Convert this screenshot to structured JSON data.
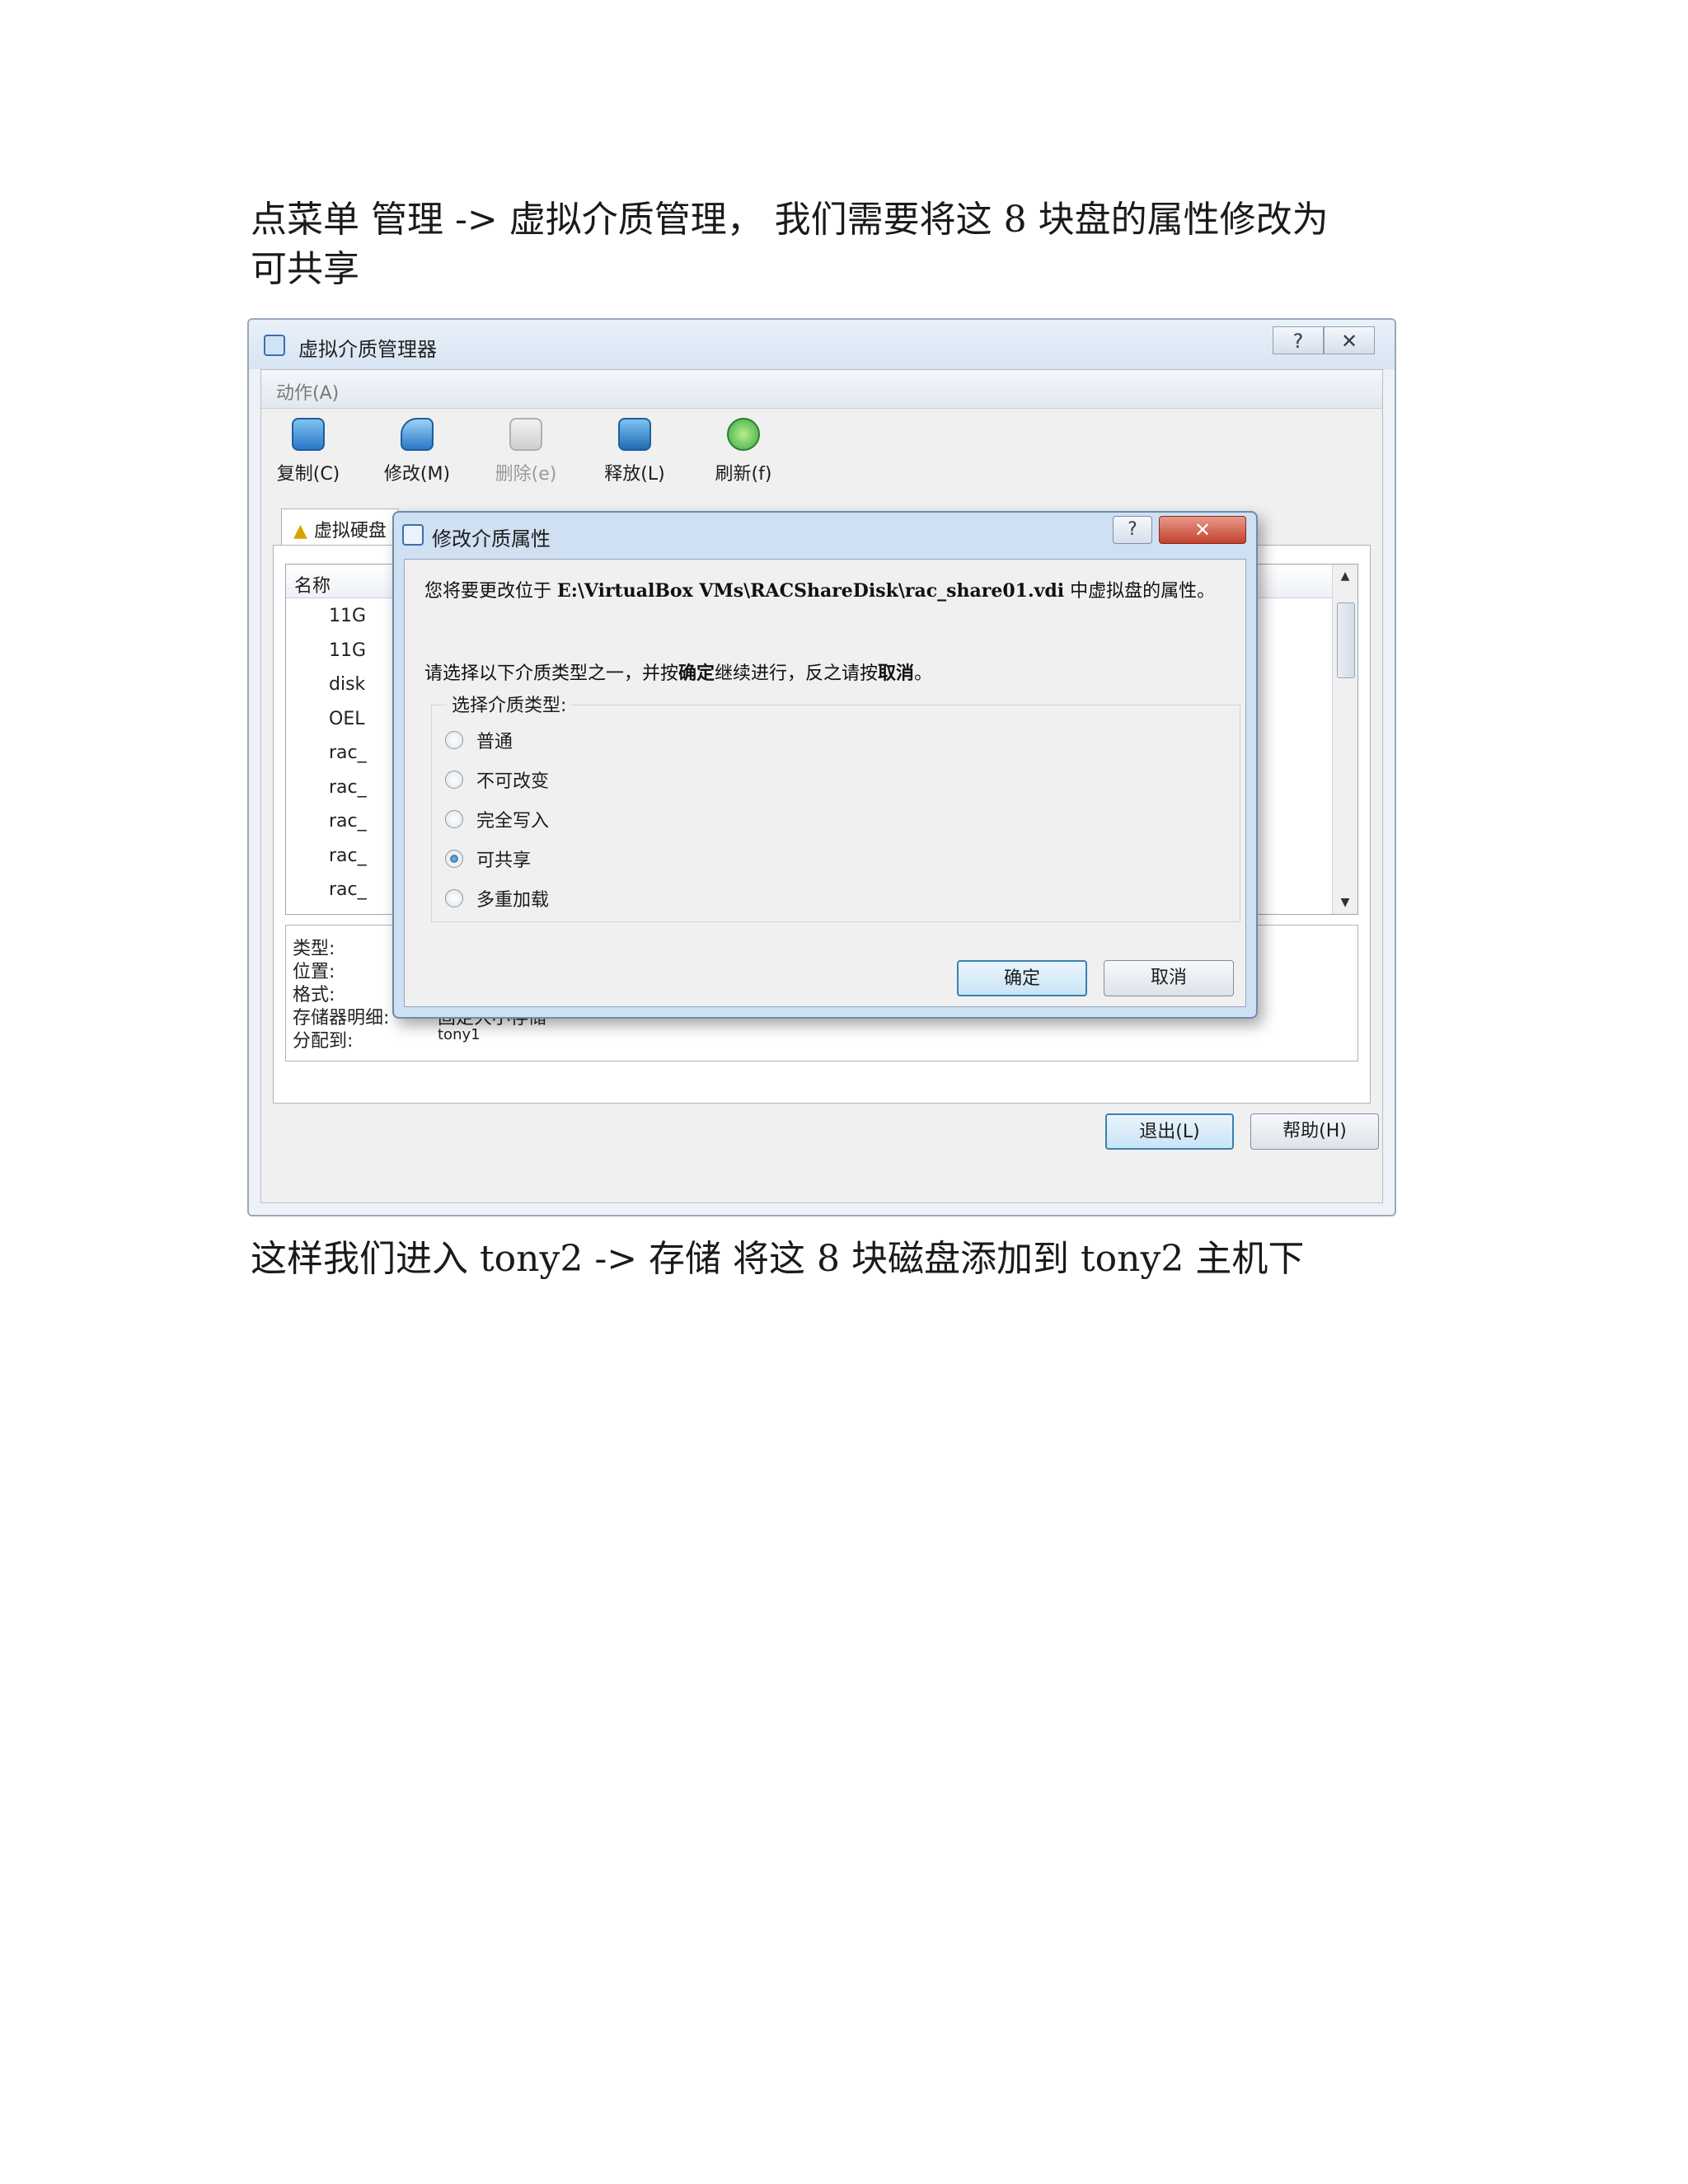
{
  "paragraphs": {
    "p1_line1": "点菜单 管理 -> 虚拟介质管理， 我们需要将这 8 块盘的属性修改为",
    "p1_line2": "可共享",
    "p3": "这样我们进入 tony2 -> 存储 将这 8 块磁盘添加到 tony2 主机下"
  },
  "window": {
    "title": "虚拟介质管理器",
    "help_button": "?",
    "close_button": "✕",
    "menu": {
      "action": "动作(A)"
    },
    "toolbar": [
      {
        "label": "复制(C)",
        "icon": "copy-icon",
        "enabled": true
      },
      {
        "label": "修改(M)",
        "icon": "modify-icon",
        "enabled": true
      },
      {
        "label": "删除(e)",
        "icon": "delete-icon",
        "enabled": false
      },
      {
        "label": "释放(L)",
        "icon": "release-icon",
        "enabled": true
      },
      {
        "label": "刷新(f)",
        "icon": "refresh-icon",
        "enabled": true
      }
    ],
    "tab": {
      "label": "虚拟硬盘",
      "icon": "warning-icon"
    },
    "list": {
      "header": "名称",
      "rows": [
        "11G",
        "11G",
        "disk",
        "OEL",
        "rac_",
        "rac_",
        "rac_",
        "rac_",
        "rac_"
      ]
    },
    "details": {
      "type_label": "类型:",
      "location_label": "位置:",
      "format_label": "格式:",
      "storage_label": "存储器明细:",
      "storage_value": "固定大小存储",
      "attached_label": "分配到:",
      "attached_value": "tony1"
    },
    "buttons": {
      "exit": "退出(L)",
      "help": "帮助(H)"
    }
  },
  "dialog": {
    "title": "修改介质属性",
    "help_button": "?",
    "close_button": "✕",
    "message_prefix": "您将要更改位于 ",
    "message_path": "E:\\VirtualBox VMs\\RACShareDisk\\rac_share01.vdi",
    "message_suffix": " 中虚拟盘的属性。",
    "instruction_prefix": "请选择以下介质类型之一，并按",
    "instruction_ok": "确定",
    "instruction_mid": "继续进行，反之请按",
    "instruction_cancel": "取消",
    "instruction_end": "。",
    "group_label": "选择介质类型:",
    "options": [
      {
        "label": "普通",
        "checked": false
      },
      {
        "label": "不可改变",
        "checked": false
      },
      {
        "label": "完全写入",
        "checked": false
      },
      {
        "label": "可共享",
        "checked": true
      },
      {
        "label": "多重加载",
        "checked": false
      }
    ],
    "ok_button": "确定",
    "cancel_button": "取消"
  },
  "colors": {
    "accent": "#3c7fb1",
    "close_red": "#c2402b",
    "toolbar_icon_blue": "#2a78c8",
    "refresh_green": "#3aa845"
  }
}
